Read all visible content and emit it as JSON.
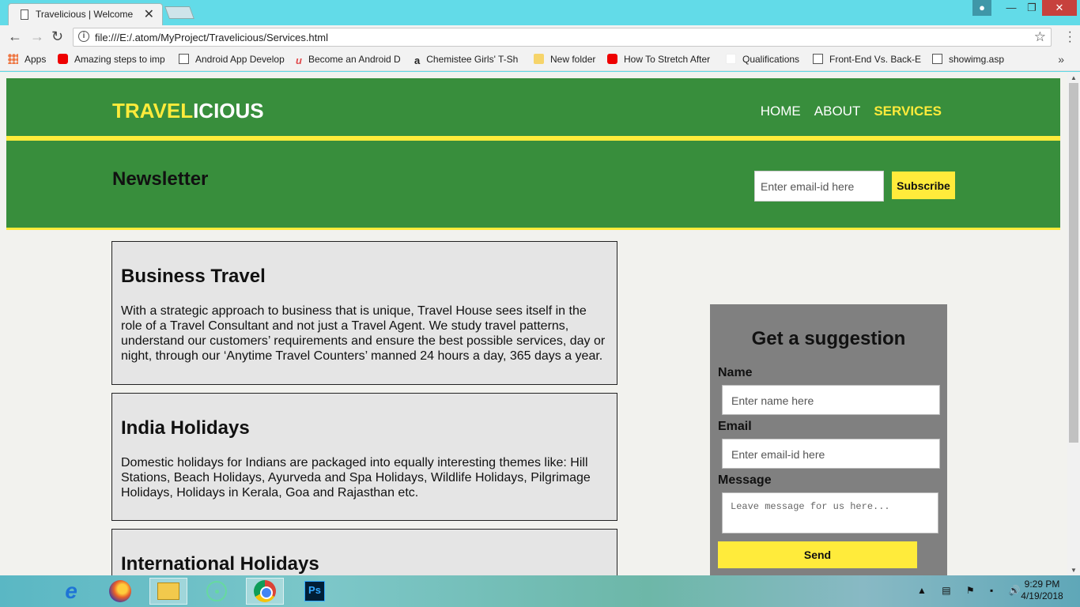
{
  "browser": {
    "tab_title": "Travelicious | Welcome",
    "tab_close": "✕",
    "url": "file:///E:/.atom/MyProject/Travelicious/Services.html",
    "bookmarks": [
      {
        "label": "Apps",
        "icon": "apps-grid-icon"
      },
      {
        "label": "Amazing steps to imp",
        "icon": "youtube-icon"
      },
      {
        "label": "Android App Develop",
        "icon": "page-icon"
      },
      {
        "label": "Become an Android D",
        "icon": "udemy-icon"
      },
      {
        "label": "Chemistee Girls' T-Sh",
        "icon": "amazon-icon"
      },
      {
        "label": "New folder",
        "icon": "folder-icon"
      },
      {
        "label": "How To Stretch After",
        "icon": "youtube-icon"
      },
      {
        "label": "Qualifications",
        "icon": "blank-icon"
      },
      {
        "label": "Front-End Vs. Back-E",
        "icon": "page-icon"
      },
      {
        "label": "showimg.asp",
        "icon": "page-icon"
      }
    ],
    "bookmarks_more": "»"
  },
  "site": {
    "logo_highlight": "TRAVEL",
    "logo_rest": "ICIOUS",
    "nav": [
      {
        "label": "HOME"
      },
      {
        "label": "ABOUT"
      },
      {
        "label": "SERVICES",
        "current": true
      }
    ],
    "newsletter": {
      "title": "Newsletter",
      "placeholder": "Enter email-id here",
      "button": "Subscribe"
    },
    "cards": [
      {
        "title": "Business Travel",
        "text": "With a strategic approach to business that is unique, Travel House sees itself in the role of a Travel Consultant and not just a Travel Agent. We study travel patterns, understand our customers’ requirements and ensure the best possible services, day or night, through our ‘Anytime Travel Counters’ manned 24 hours a day, 365 days a year."
      },
      {
        "title": "India Holidays",
        "text": "Domestic holidays for Indians are packaged into equally interesting themes like: Hill Stations, Beach Holidays, Ayurveda and Spa Holidays, Wildlife Holidays, Pilgrimage Holidays, Holidays in Kerala, Goa and Rajasthan etc."
      },
      {
        "title": "International Holidays"
      }
    ],
    "suggestion": {
      "title": "Get a suggestion",
      "name_label": "Name",
      "name_placeholder": "Enter name here",
      "email_label": "Email",
      "email_placeholder": "Enter email-id here",
      "message_label": "Message",
      "message_placeholder": "Leave message for us here...",
      "send": "Send"
    }
  },
  "taskbar": {
    "time": "9:29 PM",
    "date": "4/19/2018"
  },
  "colors": {
    "header_green": "#388e3c",
    "accent_yellow": "#ffeb3b",
    "suggest_gray": "#808080"
  }
}
